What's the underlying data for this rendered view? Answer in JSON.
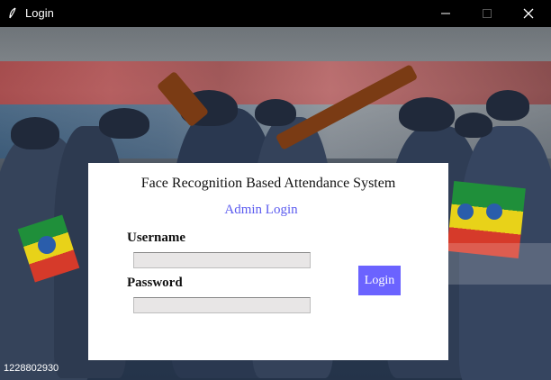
{
  "window": {
    "title": "Login",
    "app_icon": "feather-icon",
    "controls": [
      "minimize-icon",
      "maximize-icon",
      "close-icon"
    ]
  },
  "form": {
    "system_title": "Face Recognition Based Attendance System",
    "subtitle": "Admin Login",
    "username_label": "Username",
    "username_value": "",
    "password_label": "Password",
    "password_value": "",
    "login_button": "Login"
  },
  "background": {
    "corner_text": "1228802930"
  },
  "colors": {
    "accent": "#6b63ff",
    "subtitle": "#5b5bef",
    "titlebar": "#000000"
  }
}
